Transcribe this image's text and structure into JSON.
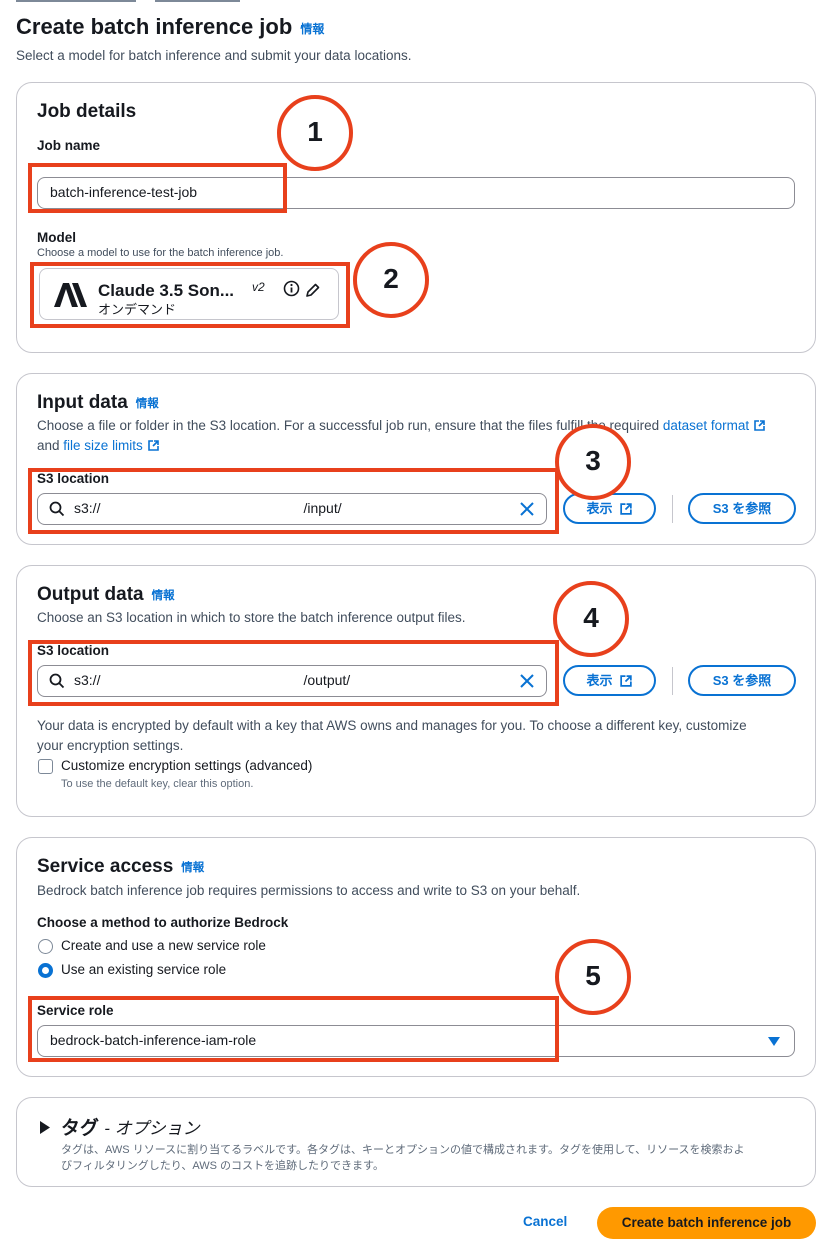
{
  "page": {
    "title": "Create batch inference job",
    "info": "情報",
    "description": "Select a model for batch inference and submit your data locations."
  },
  "job_details": {
    "title": "Job details",
    "job_name_label": "Job name",
    "job_name_value": "batch-inference-test-job",
    "model_label": "Model",
    "model_description": "Choose a model to use for the batch inference job.",
    "model_name": "Claude 3.5 Son...",
    "model_version": "v2",
    "model_mode": "オンデマンド"
  },
  "input_data": {
    "title": "Input data",
    "info": "情報",
    "description_prefix": "Choose a file or folder in the S3 location. For a successful job run, ensure that the files fulfill the required",
    "link_dataset_format": "dataset format",
    "and_text": "and",
    "link_file_size_limits": "file size limits",
    "s3_label": "S3 location",
    "s3_prefix": "s3://",
    "s3_suffix": "/input/",
    "view_button": "表示",
    "browse_button": "S3 を参照"
  },
  "output_data": {
    "title": "Output data",
    "info": "情報",
    "description": "Choose an S3 location in which to store the batch inference output files.",
    "s3_label": "S3 location",
    "s3_prefix": "s3://",
    "s3_suffix": "/output/",
    "view_button": "表示",
    "browse_button": "S3 を参照",
    "encryption_text_1": "Your data is encrypted by default with a key that AWS owns and manages for you. To choose a different key, customize",
    "encryption_text_2": "your encryption settings.",
    "customize_label": "Customize encryption settings (advanced)",
    "customize_hint": "To use the default key, clear this option.",
    "customize_checked": false
  },
  "service_access": {
    "title": "Service access",
    "info": "情報",
    "description": "Bedrock batch inference job requires permissions to access and write to S3 on your behalf.",
    "method_label": "Choose a method to authorize Bedrock",
    "option_new": "Create and use a new service role",
    "option_existing": "Use an existing service role",
    "selected": "existing",
    "role_label": "Service role",
    "role_value": "bedrock-batch-inference-iam-role"
  },
  "tags": {
    "title": "タグ",
    "optional": "- オプション",
    "description_1": "タグは、AWS リソースに割り当てるラベルです。各タグは、キーとオプションの値で構成されます。タグを使用して、リソースを検索およ",
    "description_2": "びフィルタリングしたり、AWS のコストを追跡したりできます。"
  },
  "footer": {
    "cancel": "Cancel",
    "submit": "Create batch inference job"
  },
  "annotations": [
    "1",
    "2",
    "3",
    "4",
    "5"
  ],
  "colors": {
    "accent": "#0972d3",
    "primary_button": "#ff9900",
    "annotation": "#e8401c"
  }
}
